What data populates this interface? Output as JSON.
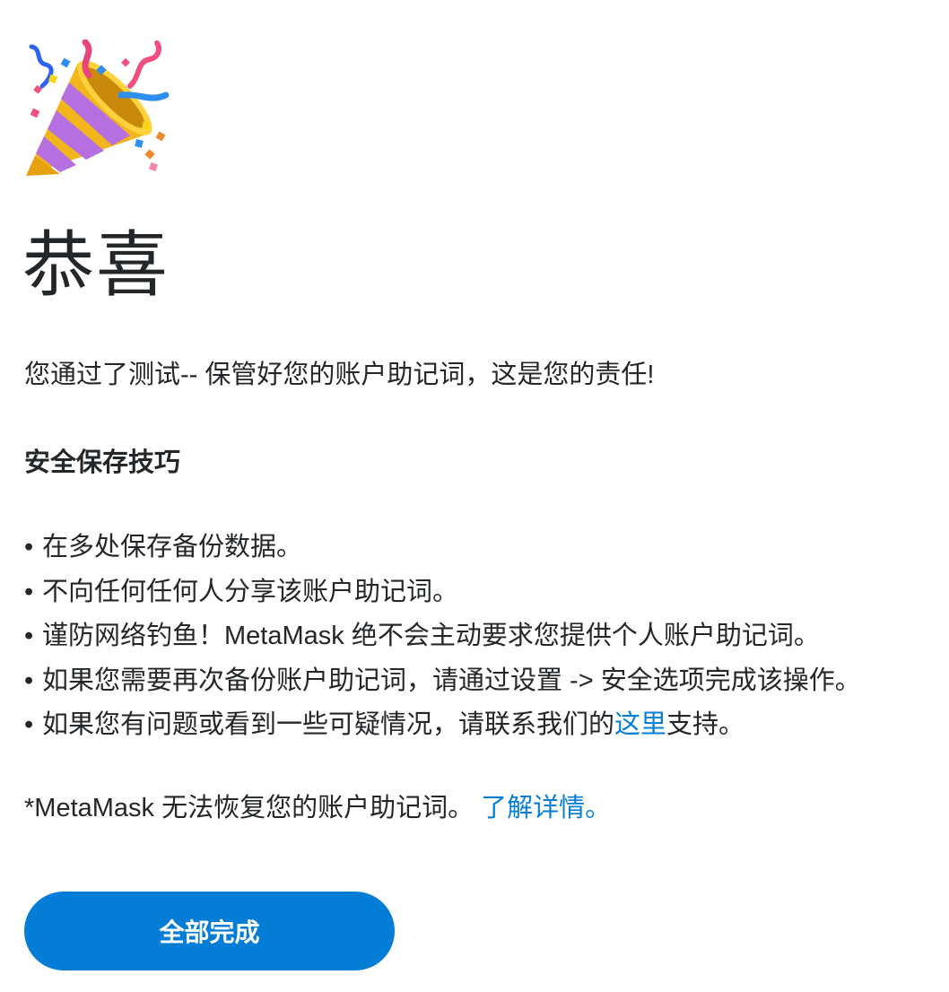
{
  "icon": "party-popper-icon",
  "title": "恭喜",
  "intro": "您通过了测试-- 保管好您的账户助记词，这是您的责任!",
  "tips": {
    "heading": "安全保存技巧",
    "items": [
      "在多处保存备份数据。",
      "不向任何任何人分享该账户助记词。",
      "谨防网络钓鱼！MetaMask 绝不会主动要求您提供个人账户助记词。",
      "如果您需要再次备份账户助记词，请通过设置 -> 安全选项完成该操作。"
    ],
    "last_item": {
      "before": "如果您有问题或看到一些可疑情况，请联系我们的",
      "link": "这里",
      "after": "支持。"
    }
  },
  "footnote": {
    "text": "*MetaMask 无法恢复您的账户助记词。",
    "link": "了解详情。"
  },
  "done_button": "全部完成",
  "colors": {
    "accent": "#037dd6",
    "text": "#24272a",
    "background": "#ffffff"
  }
}
